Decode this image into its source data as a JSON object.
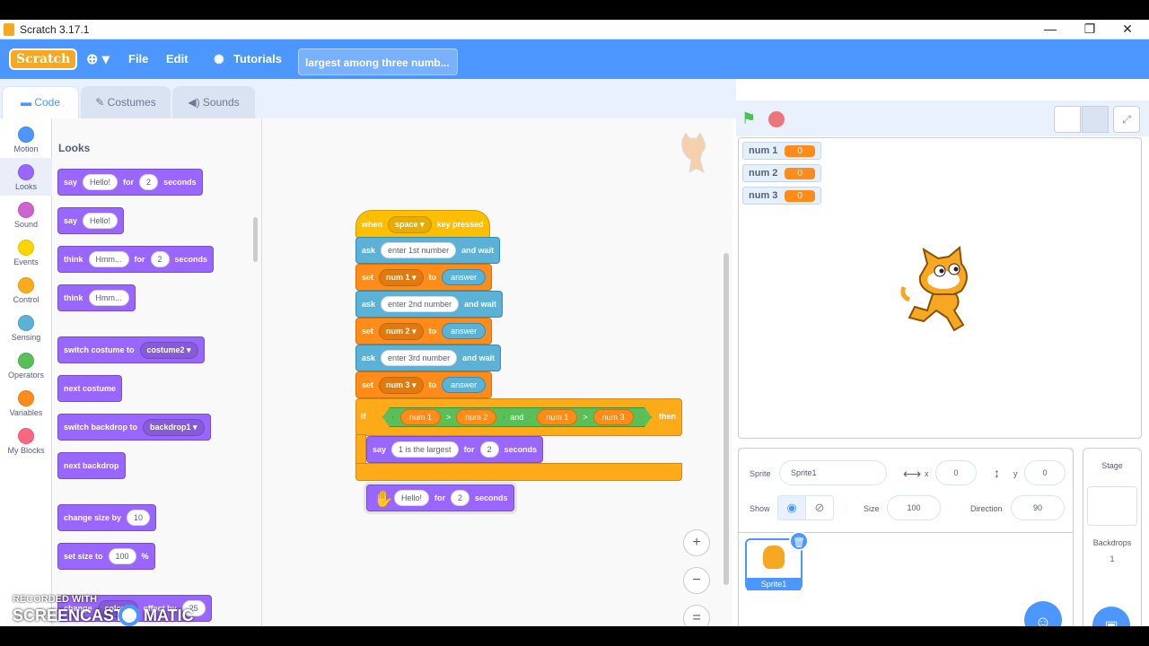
{
  "titlebar": {
    "title": "Scratch 3.17.1",
    "minimize": "—",
    "maximize": "❐",
    "close": "✕"
  },
  "menubar": {
    "logo": "Scratch",
    "globe_icon": "globe-icon",
    "items": [
      "File",
      "Edit",
      "Tutorials"
    ],
    "project_title": "largest among three numb..."
  },
  "tabs": {
    "code": "Code",
    "costumes": "Costumes",
    "sounds": "Sounds"
  },
  "categories": [
    {
      "label": "Motion",
      "color": "#4c97ff"
    },
    {
      "label": "Looks",
      "color": "#9966ff"
    },
    {
      "label": "Sound",
      "color": "#cf63cf"
    },
    {
      "label": "Events",
      "color": "#ffd500"
    },
    {
      "label": "Control",
      "color": "#ffab19"
    },
    {
      "label": "Sensing",
      "color": "#5cb1d6"
    },
    {
      "label": "Operators",
      "color": "#59c059"
    },
    {
      "label": "Variables",
      "color": "#ff8c1a"
    },
    {
      "label": "My Blocks",
      "color": "#ff6680"
    }
  ],
  "palette": {
    "title": "Looks",
    "say_for": {
      "say": "say",
      "msg": "Hello!",
      "for": "for",
      "secs": "2",
      "seconds": "seconds"
    },
    "say": {
      "say": "say",
      "msg": "Hello!"
    },
    "think_for": {
      "think": "think",
      "msg": "Hmm...",
      "for": "for",
      "secs": "2",
      "seconds": "seconds"
    },
    "think": {
      "think": "think",
      "msg": "Hmm..."
    },
    "switch_costume": {
      "label": "switch costume to",
      "value": "costume2"
    },
    "next_costume": "next costume",
    "switch_backdrop": {
      "label": "switch backdrop to",
      "value": "backdrop1"
    },
    "next_backdrop": "next backdrop",
    "change_size": {
      "label": "change size by",
      "value": "10"
    },
    "set_size": {
      "label": "set size to",
      "value": "100",
      "unit": "%"
    },
    "change_effect": {
      "label": "change",
      "effect": "color",
      "by": "effect by",
      "value": "25"
    }
  },
  "script": {
    "hat": {
      "when": "when",
      "key": "space",
      "pressed": "key pressed"
    },
    "ask1": {
      "ask": "ask",
      "q": "enter 1st number",
      "wait": "and wait"
    },
    "set1": {
      "set": "set",
      "var": "num 1",
      "to": "to",
      "val": "answer"
    },
    "ask2": {
      "ask": "ask",
      "q": "enter 2nd number",
      "wait": "and wait"
    },
    "set2": {
      "set": "set",
      "var": "num 2",
      "to": "to",
      "val": "answer"
    },
    "ask3": {
      "ask": "ask",
      "q": "enter 3rd number",
      "wait": "and wait"
    },
    "set3": {
      "set": "set",
      "var": "num 3",
      "to": "to",
      "val": "answer"
    },
    "if": {
      "if": "if",
      "a1": "num 1",
      "op1": ">",
      "b1": "num 2",
      "and": "and",
      "a2": "num 1",
      "op2": ">",
      "b2": "num 3",
      "then": "then"
    },
    "say_largest": {
      "say": "say",
      "msg": "1 is the largest",
      "for": "for",
      "secs": "2",
      "seconds": "seconds"
    },
    "dragged": {
      "msg": "Hello!",
      "for": "for",
      "secs": "2",
      "seconds": "seconds"
    },
    "zoom_in": "+",
    "zoom_out": "−",
    "zoom_reset": "="
  },
  "stage": {
    "monitors": [
      {
        "name": "num 1",
        "value": "0"
      },
      {
        "name": "num 2",
        "value": "0"
      },
      {
        "name": "num 3",
        "value": "0"
      }
    ]
  },
  "sprite_info": {
    "sprite_label": "Sprite",
    "sprite_name": "Sprite1",
    "x_label": "x",
    "x": "0",
    "y_label": "y",
    "y": "0",
    "show_label": "Show",
    "size_label": "Size",
    "size": "100",
    "direction_label": "Direction",
    "direction": "90",
    "thumb_name": "Sprite1"
  },
  "stage_col": {
    "title": "Stage",
    "backdrops_label": "Backdrops",
    "backdrops_count": "1"
  },
  "watermark": {
    "line1": "RECORDED WITH",
    "line2": "SCREENCAST",
    "line3": "MATIC"
  }
}
